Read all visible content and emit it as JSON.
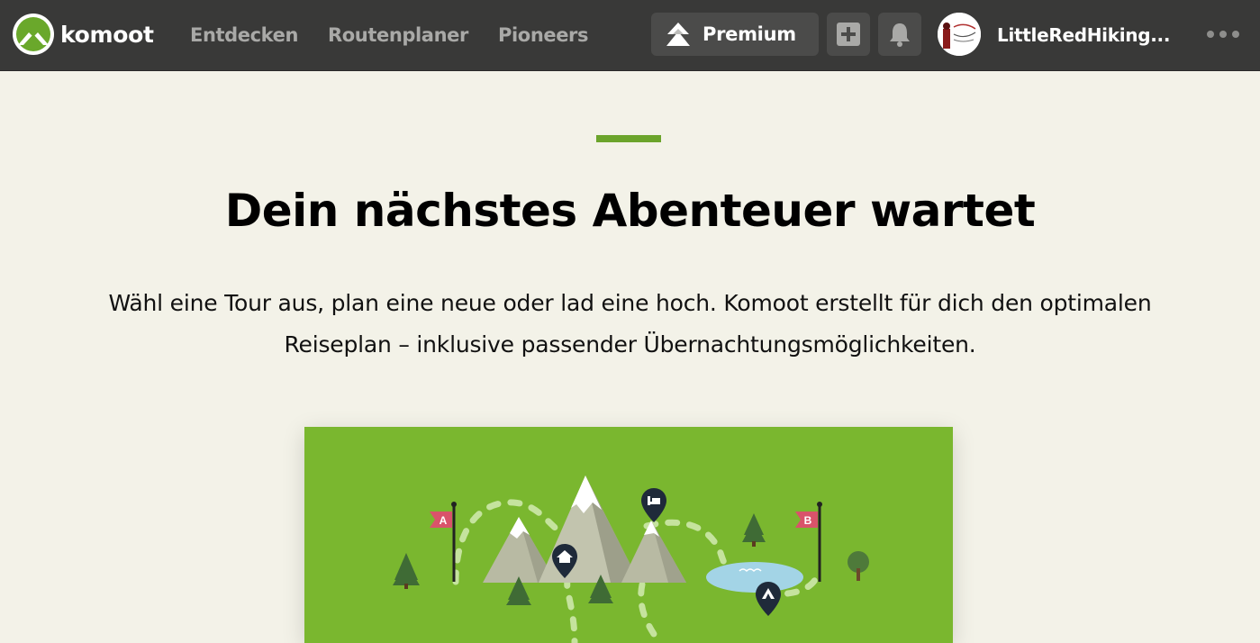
{
  "header": {
    "logo_text": "komoot",
    "nav": [
      {
        "label": "Entdecken"
      },
      {
        "label": "Routenplaner"
      },
      {
        "label": "Pioneers"
      }
    ],
    "premium_label": "Premium",
    "username": "LittleRedHiking..."
  },
  "main": {
    "headline": "Dein nächstes Abenteuer wartet",
    "subtext_line1": "Wähl eine Tour aus, plan eine neue oder lad eine hoch. Komoot erstellt für dich den optimalen",
    "subtext_line2": "Reiseplan – inklusive passender Übernachtungsmöglichkeiten.",
    "illustration": {
      "flag_start": "A",
      "flag_end": "B"
    }
  },
  "colors": {
    "topbar": "#393938",
    "brand_green": "#6ba42b",
    "hero_green": "#7ab72f",
    "page_bg": "#f3f2e8"
  },
  "icons": [
    "komoot-logo-icon",
    "premium-mountain-icon",
    "plus-icon",
    "bell-icon",
    "more-dots-icon",
    "home-pin-icon",
    "bed-pin-icon",
    "tent-pin-icon"
  ]
}
